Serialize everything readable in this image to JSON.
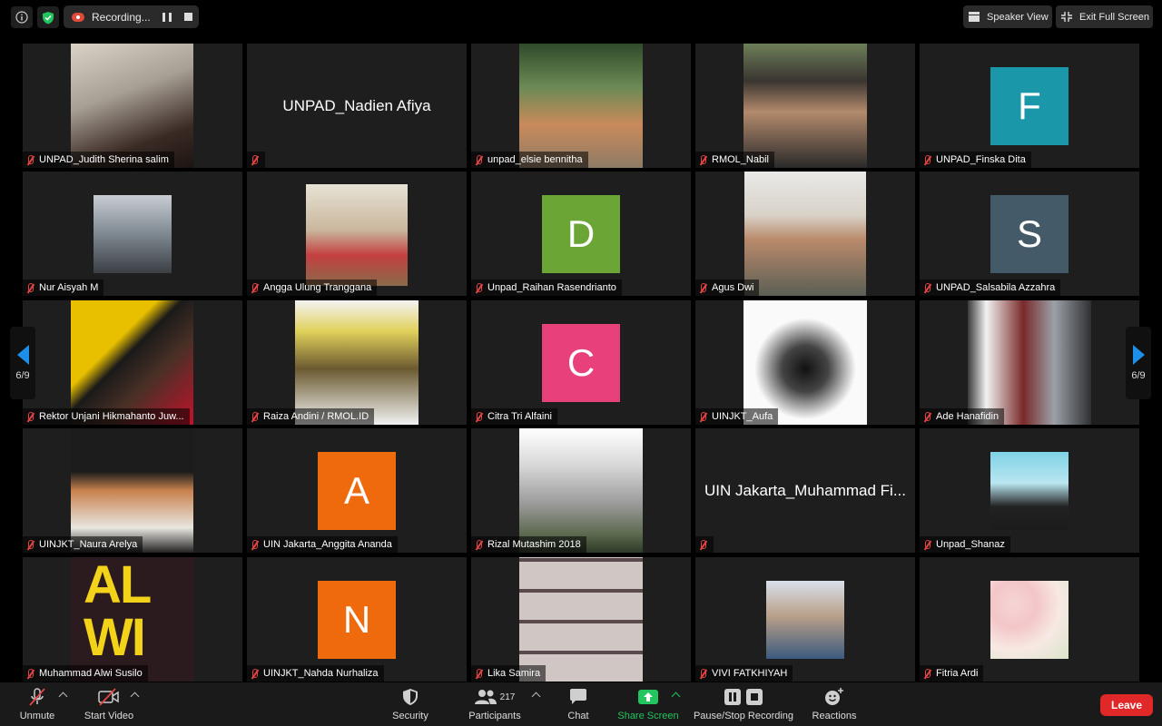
{
  "top": {
    "recording_label": "Recording...",
    "speaker_view": "Speaker View",
    "exit_full_screen": "Exit Full Screen"
  },
  "pager": {
    "left": "6/9",
    "right": "6/9"
  },
  "tiles": [
    {
      "name": "UNPAD_Judith Sherina salim",
      "type": "video"
    },
    {
      "name": "",
      "display_name": "UNPAD_Nadien Afiya",
      "type": "name"
    },
    {
      "name": "unpad_elsie bennitha",
      "type": "video"
    },
    {
      "name": "RMOL_Nabil",
      "type": "video"
    },
    {
      "name": "UNPAD_Finska Dita",
      "type": "avatar",
      "letter": "F",
      "color": "#1a97a8"
    },
    {
      "name": "Nur Aisyah M",
      "type": "video"
    },
    {
      "name": "Angga Ulung Tranggana",
      "type": "video"
    },
    {
      "name": "Unpad_Raihan Rasendrianto",
      "type": "avatar",
      "letter": "D",
      "color": "#6aa536"
    },
    {
      "name": "Agus Dwi",
      "type": "video"
    },
    {
      "name": "UNPAD_Salsabila Azzahra",
      "type": "avatar",
      "letter": "S",
      "color": "#455a68"
    },
    {
      "name": "Rektor Unjani Hikmahanto Juw...",
      "type": "video"
    },
    {
      "name": "Raiza Andini / RMOL.ID",
      "type": "video"
    },
    {
      "name": "Citra Tri Alfaini",
      "type": "avatar",
      "letter": "C",
      "color": "#e8407a"
    },
    {
      "name": "UINJKT_Aufa",
      "type": "video"
    },
    {
      "name": "Ade Hanafidin",
      "type": "video"
    },
    {
      "name": "UINJKT_Naura Arelya",
      "type": "video"
    },
    {
      "name": "UIN Jakarta_Anggita Ananda",
      "type": "avatar",
      "letter": "A",
      "color": "#ef6a0c"
    },
    {
      "name": "Rizal Mutashim 2018",
      "type": "video"
    },
    {
      "name": "",
      "display_name": "UIN Jakarta_Muhammad Fi...",
      "type": "name"
    },
    {
      "name": "Unpad_Shanaz",
      "type": "video"
    },
    {
      "name": "Muhammad Alwi Susilo",
      "type": "video",
      "overlay_text": "AL\nWI"
    },
    {
      "name": "UINJKT_Nahda Nurhaliza",
      "type": "avatar",
      "letter": "N",
      "color": "#ef6a0c"
    },
    {
      "name": "Lika Samira",
      "type": "video"
    },
    {
      "name": "VIVI FATKHIYAH",
      "type": "video"
    },
    {
      "name": "Fitria Ardi",
      "type": "video"
    }
  ],
  "toolbar": {
    "unmute": "Unmute",
    "start_video": "Start Video",
    "security": "Security",
    "participants": "Participants",
    "participant_count": "217",
    "chat": "Chat",
    "share_screen": "Share Screen",
    "pause_stop_recording": "Pause/Stop Recording",
    "reactions": "Reactions",
    "leave": "Leave"
  },
  "colors": {
    "accent_blue": "#1e8fe8",
    "share_green": "#22c55e",
    "leave_red": "#e02828",
    "mute_red": "#e64444"
  }
}
